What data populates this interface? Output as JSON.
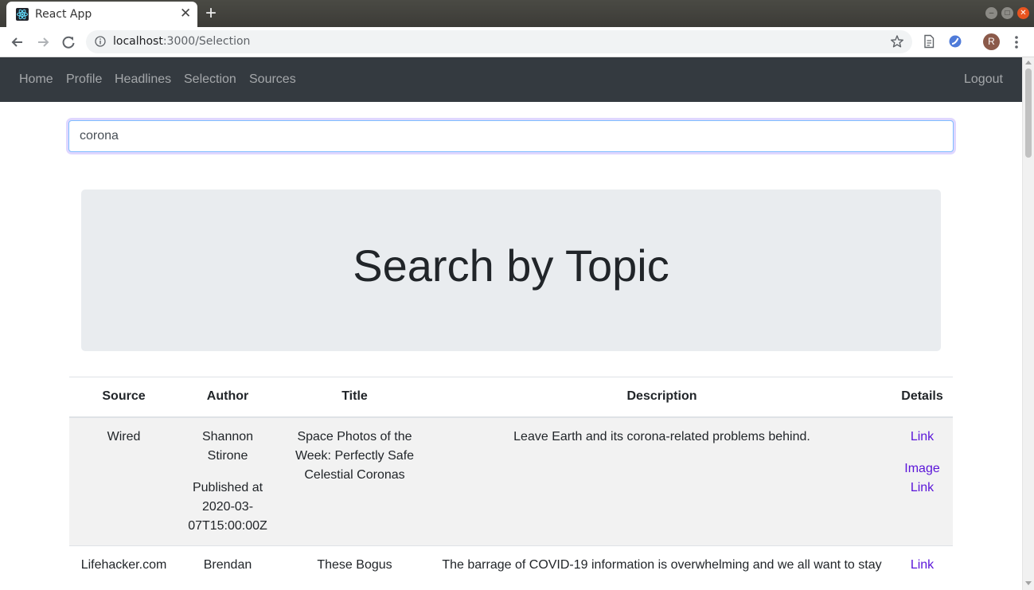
{
  "browser": {
    "tab_title": "React App",
    "url_host": "localhost",
    "url_rest": ":3000/Selection",
    "avatar_letter": "R"
  },
  "navbar": {
    "links": [
      "Home",
      "Profile",
      "Headlines",
      "Selection",
      "Sources"
    ],
    "logout_label": "Logout"
  },
  "search": {
    "value": "corona"
  },
  "jumbotron": {
    "title": "Search by Topic"
  },
  "table": {
    "headers": {
      "source": "Source",
      "author": "Author",
      "title": "Title",
      "description": "Description",
      "details": "Details"
    },
    "rows": [
      {
        "source": "Wired",
        "author": "Shannon Stirone",
        "published": "Published at 2020-03-07T15:00:00Z",
        "title": "Space Photos of the Week: Perfectly Safe Celestial Coronas",
        "description": "Leave Earth and its corona-related problems behind.",
        "link_label": "Link",
        "image_link_label": "Image Link"
      },
      {
        "source": "Lifehacker.com",
        "author": "Brendan",
        "title": "These Bogus",
        "description": "The barrage of COVID-19 information is overwhelming and we all want to stay",
        "link_label": "Link"
      }
    ]
  },
  "colors": {
    "navbar_bg": "#343a40",
    "jumbotron_bg": "#e9ecef",
    "link": "#5a14d9",
    "focus_border": "#80bdff"
  }
}
